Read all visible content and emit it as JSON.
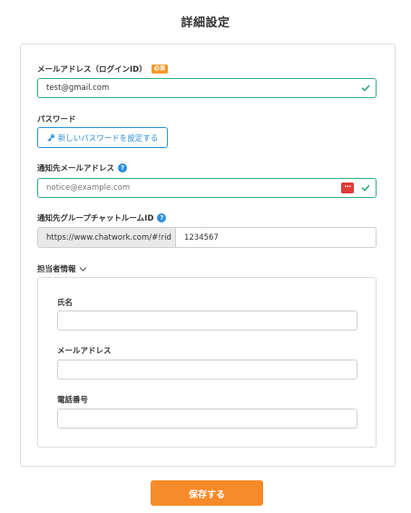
{
  "page": {
    "title": "詳細設定"
  },
  "form": {
    "email": {
      "label": "メールアドレス（ログインID）",
      "required_badge": "必須",
      "value": "test@gmail.com",
      "status_icon": "check-icon"
    },
    "password": {
      "label": "パスワード",
      "button_label": "新しいパスワードを設定する",
      "button_icon": "key-icon"
    },
    "notify_email": {
      "label": "通知先メールアドレス",
      "help_icon": "?",
      "placeholder": "notice@example.com",
      "badge_icon": "more-dots-icon",
      "badge_text": "···",
      "status_icon": "check-icon"
    },
    "chatwork_room": {
      "label": "通知先グループチャットルームID",
      "help_icon": "?",
      "prefix": "https://www.chatwork.com/#!rid",
      "value": "1234567"
    },
    "contact_section": {
      "toggle_label": "担当者情報",
      "toggle_icon": "chevron-down-icon",
      "fields": {
        "name_label": "氏名",
        "email_label": "メールアドレス",
        "phone_label": "電話番号"
      }
    }
  },
  "actions": {
    "save_label": "保存する"
  },
  "colors": {
    "accent_orange": "#f78a2a",
    "valid_green": "#2fae7a",
    "link_blue": "#2b8fd9",
    "badge_red": "#e03a3a"
  }
}
